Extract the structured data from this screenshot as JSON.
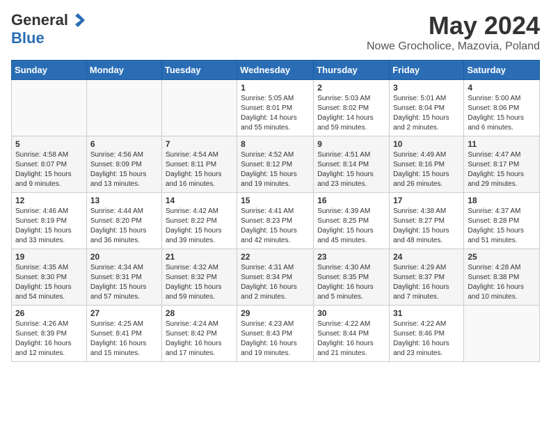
{
  "header": {
    "logo_general": "General",
    "logo_blue": "Blue",
    "month_title": "May 2024",
    "location": "Nowe Grocholice, Mazovia, Poland"
  },
  "calendar": {
    "headers": [
      "Sunday",
      "Monday",
      "Tuesday",
      "Wednesday",
      "Thursday",
      "Friday",
      "Saturday"
    ],
    "weeks": [
      [
        {
          "day": "",
          "info": ""
        },
        {
          "day": "",
          "info": ""
        },
        {
          "day": "",
          "info": ""
        },
        {
          "day": "1",
          "info": "Sunrise: 5:05 AM\nSunset: 8:01 PM\nDaylight: 14 hours\nand 55 minutes."
        },
        {
          "day": "2",
          "info": "Sunrise: 5:03 AM\nSunset: 8:02 PM\nDaylight: 14 hours\nand 59 minutes."
        },
        {
          "day": "3",
          "info": "Sunrise: 5:01 AM\nSunset: 8:04 PM\nDaylight: 15 hours\nand 2 minutes."
        },
        {
          "day": "4",
          "info": "Sunrise: 5:00 AM\nSunset: 8:06 PM\nDaylight: 15 hours\nand 6 minutes."
        }
      ],
      [
        {
          "day": "5",
          "info": "Sunrise: 4:58 AM\nSunset: 8:07 PM\nDaylight: 15 hours\nand 9 minutes."
        },
        {
          "day": "6",
          "info": "Sunrise: 4:56 AM\nSunset: 8:09 PM\nDaylight: 15 hours\nand 13 minutes."
        },
        {
          "day": "7",
          "info": "Sunrise: 4:54 AM\nSunset: 8:11 PM\nDaylight: 15 hours\nand 16 minutes."
        },
        {
          "day": "8",
          "info": "Sunrise: 4:52 AM\nSunset: 8:12 PM\nDaylight: 15 hours\nand 19 minutes."
        },
        {
          "day": "9",
          "info": "Sunrise: 4:51 AM\nSunset: 8:14 PM\nDaylight: 15 hours\nand 23 minutes."
        },
        {
          "day": "10",
          "info": "Sunrise: 4:49 AM\nSunset: 8:16 PM\nDaylight: 15 hours\nand 26 minutes."
        },
        {
          "day": "11",
          "info": "Sunrise: 4:47 AM\nSunset: 8:17 PM\nDaylight: 15 hours\nand 29 minutes."
        }
      ],
      [
        {
          "day": "12",
          "info": "Sunrise: 4:46 AM\nSunset: 8:19 PM\nDaylight: 15 hours\nand 33 minutes."
        },
        {
          "day": "13",
          "info": "Sunrise: 4:44 AM\nSunset: 8:20 PM\nDaylight: 15 hours\nand 36 minutes."
        },
        {
          "day": "14",
          "info": "Sunrise: 4:42 AM\nSunset: 8:22 PM\nDaylight: 15 hours\nand 39 minutes."
        },
        {
          "day": "15",
          "info": "Sunrise: 4:41 AM\nSunset: 8:23 PM\nDaylight: 15 hours\nand 42 minutes."
        },
        {
          "day": "16",
          "info": "Sunrise: 4:39 AM\nSunset: 8:25 PM\nDaylight: 15 hours\nand 45 minutes."
        },
        {
          "day": "17",
          "info": "Sunrise: 4:38 AM\nSunset: 8:27 PM\nDaylight: 15 hours\nand 48 minutes."
        },
        {
          "day": "18",
          "info": "Sunrise: 4:37 AM\nSunset: 8:28 PM\nDaylight: 15 hours\nand 51 minutes."
        }
      ],
      [
        {
          "day": "19",
          "info": "Sunrise: 4:35 AM\nSunset: 8:30 PM\nDaylight: 15 hours\nand 54 minutes."
        },
        {
          "day": "20",
          "info": "Sunrise: 4:34 AM\nSunset: 8:31 PM\nDaylight: 15 hours\nand 57 minutes."
        },
        {
          "day": "21",
          "info": "Sunrise: 4:32 AM\nSunset: 8:32 PM\nDaylight: 15 hours\nand 59 minutes."
        },
        {
          "day": "22",
          "info": "Sunrise: 4:31 AM\nSunset: 8:34 PM\nDaylight: 16 hours\nand 2 minutes."
        },
        {
          "day": "23",
          "info": "Sunrise: 4:30 AM\nSunset: 8:35 PM\nDaylight: 16 hours\nand 5 minutes."
        },
        {
          "day": "24",
          "info": "Sunrise: 4:29 AM\nSunset: 8:37 PM\nDaylight: 16 hours\nand 7 minutes."
        },
        {
          "day": "25",
          "info": "Sunrise: 4:28 AM\nSunset: 8:38 PM\nDaylight: 16 hours\nand 10 minutes."
        }
      ],
      [
        {
          "day": "26",
          "info": "Sunrise: 4:26 AM\nSunset: 8:39 PM\nDaylight: 16 hours\nand 12 minutes."
        },
        {
          "day": "27",
          "info": "Sunrise: 4:25 AM\nSunset: 8:41 PM\nDaylight: 16 hours\nand 15 minutes."
        },
        {
          "day": "28",
          "info": "Sunrise: 4:24 AM\nSunset: 8:42 PM\nDaylight: 16 hours\nand 17 minutes."
        },
        {
          "day": "29",
          "info": "Sunrise: 4:23 AM\nSunset: 8:43 PM\nDaylight: 16 hours\nand 19 minutes."
        },
        {
          "day": "30",
          "info": "Sunrise: 4:22 AM\nSunset: 8:44 PM\nDaylight: 16 hours\nand 21 minutes."
        },
        {
          "day": "31",
          "info": "Sunrise: 4:22 AM\nSunset: 8:46 PM\nDaylight: 16 hours\nand 23 minutes."
        },
        {
          "day": "",
          "info": ""
        }
      ]
    ]
  }
}
